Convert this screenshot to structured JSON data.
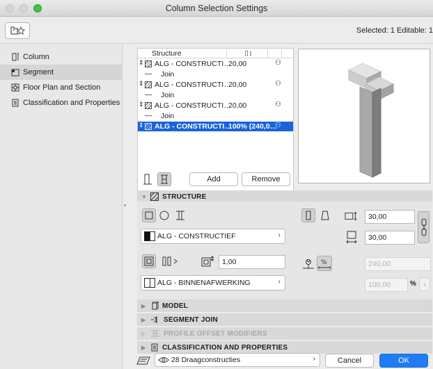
{
  "window": {
    "title": "Column Selection Settings"
  },
  "topbar": {
    "selected_info": "Selected: 1 Editable: 1"
  },
  "sidebar": {
    "items": [
      {
        "label": "Column",
        "icon": "column-icon"
      },
      {
        "label": "Segment",
        "icon": "segment-icon"
      },
      {
        "label": "Floor Plan and Section",
        "icon": "floor-plan-icon"
      },
      {
        "label": "Classification and Properties",
        "icon": "classification-icon"
      }
    ],
    "active_index": 1
  },
  "structure_list": {
    "headers": [
      "Structure",
      "⌷↕"
    ],
    "rows": [
      {
        "type": "segment",
        "name": "ALG - CONSTRUCTI…",
        "value": "20,00"
      },
      {
        "type": "join",
        "name": "Join"
      },
      {
        "type": "segment",
        "name": "ALG - CONSTRUCTI…",
        "value": "20,00"
      },
      {
        "type": "join",
        "name": "Join"
      },
      {
        "type": "segment",
        "name": "ALG - CONSTRUCTI…",
        "value": "20,00"
      },
      {
        "type": "join",
        "name": "Join"
      },
      {
        "type": "segment",
        "name": "ALG - CONSTRUCTI…",
        "value": "100% (240,0…",
        "selected": true
      }
    ],
    "add_label": "Add",
    "remove_label": "Remove"
  },
  "structure_section": {
    "title": "STRUCTURE",
    "material_core": "ALG - CONSTRUCTIEF",
    "veneer_thickness": "1,00",
    "material_veneer": "ALG - BINNENAFWERKING",
    "width": "30,00",
    "depth": "30,00",
    "height_dim": "240,00",
    "percent_value": "100,00",
    "percent_unit": "%"
  },
  "sections": [
    {
      "title": "MODEL",
      "icon": "model-icon",
      "disabled": false
    },
    {
      "title": "SEGMENT JOIN",
      "icon": "segment-join-icon",
      "disabled": false
    },
    {
      "title": "PROFILE OFFSET MODIFIERS",
      "icon": "profile-offset-icon",
      "disabled": true
    },
    {
      "title": "CLASSIFICATION AND PROPERTIES",
      "icon": "classification-icon",
      "disabled": false
    }
  ],
  "footer": {
    "layer_value": "28 Draagconstructies",
    "cancel_label": "Cancel",
    "ok_label": "OK"
  },
  "colors": {
    "selection_blue": "#1a63d8",
    "ok_button": "#1f7cf5",
    "traffic_green": "#3ec44b"
  }
}
